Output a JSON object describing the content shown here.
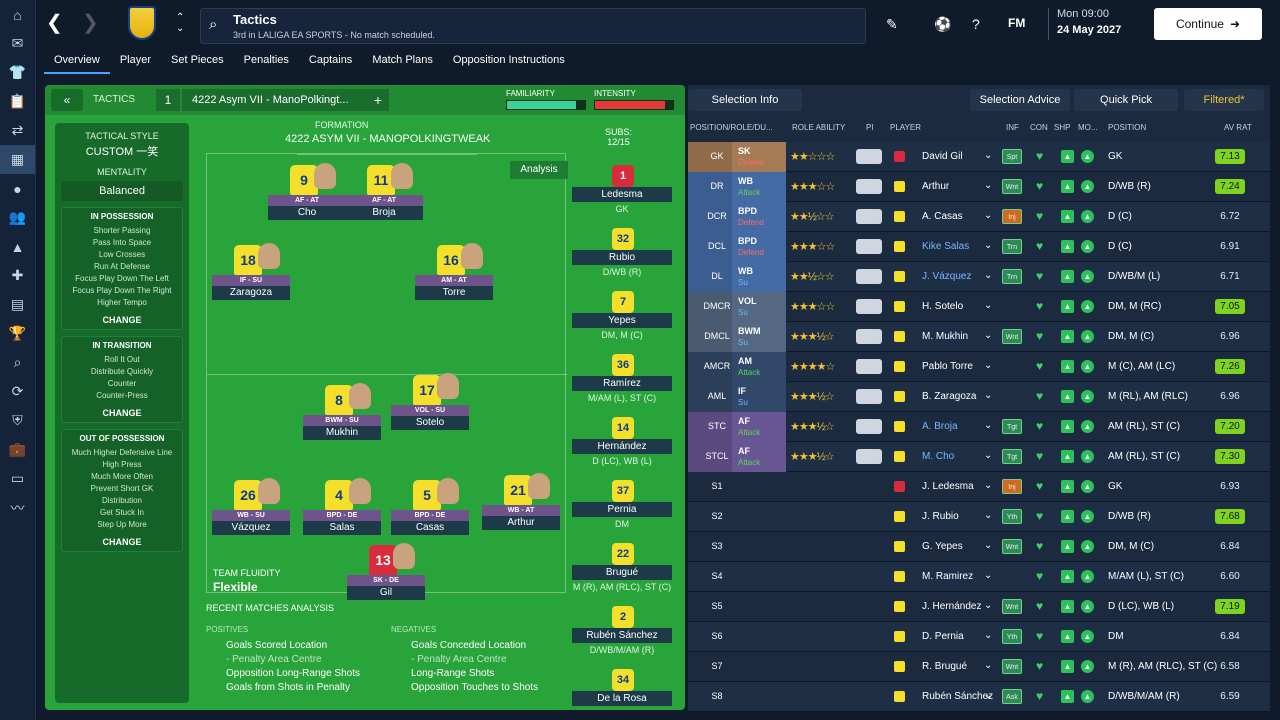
{
  "header": {
    "title": "Tactics",
    "subtitle": "3rd in LALIGA EA SPORTS - No match scheduled.",
    "date_day": "Mon 09:00",
    "date_full": "24 May 2027",
    "continue_label": "Continue",
    "fm_label": "FM"
  },
  "tabs": [
    "Overview",
    "Player",
    "Set Pieces",
    "Penalties",
    "Captains",
    "Match Plans",
    "Opposition Instructions"
  ],
  "tactics": {
    "label": "TACTICS",
    "slot": "1",
    "name": "4222 Asym VII - ManoPolkingt...",
    "familiarity_label": "FAMILIARITY",
    "intensity_label": "INTENSITY",
    "familiarity": 0.88,
    "intensity": 0.9,
    "style_title": "TACTICAL STYLE",
    "style_value": "CUSTOM 一笑",
    "mentality_title": "MENTALITY",
    "mentality_value": "Balanced",
    "possession_title": "IN POSSESSION",
    "possession_items": [
      "Shorter Passing",
      "Pass Into Space",
      "Low Crosses",
      "Run At Defense",
      "Focus Play Down The Left",
      "Focus Play Down The Right",
      "Higher Tempo"
    ],
    "transition_title": "IN TRANSITION",
    "transition_items": [
      "Roll It Out",
      "Distribute Quickly",
      "Counter",
      "Counter-Press"
    ],
    "oop_title": "OUT OF POSSESSION",
    "oop_items": [
      "Much Higher Defensive Line",
      "High Press",
      "Much More Often",
      "Prevent Short GK",
      "Distribution",
      "Get Stuck In",
      "Step Up More"
    ],
    "change_label": "CHANGE",
    "formation_title": "FORMATION",
    "formation_name": "4222 ASYM VII - MANOPOLKINGTWEAK",
    "subs_label": "SUBS:",
    "subs_count": "12/15",
    "analysis_label": "Analysis",
    "fluidity_label": "TEAM FLUIDITY",
    "fluidity_value": "Flexible",
    "recent_label": "RECENT MATCHES ANALYSIS",
    "positives_label": "POSITIVES",
    "negatives_label": "NEGATIVES",
    "positives": [
      "Goals Scored Location",
      "- Penalty Area Centre",
      "Opposition Long-Range Shots",
      "Goals from Shots in Penalty"
    ],
    "negatives": [
      "Goals Conceded Location",
      "- Penalty Area Centre",
      "Long-Range Shots",
      "Opposition Touches to Shots"
    ]
  },
  "pitch_players": [
    {
      "num": "9",
      "role": "AF - AT",
      "name": "Cho"
    },
    {
      "num": "11",
      "role": "AF - AT",
      "name": "Broja"
    },
    {
      "num": "18",
      "role": "IF - SU",
      "name": "Zaragoza"
    },
    {
      "num": "16",
      "role": "AM - AT",
      "name": "Torre"
    },
    {
      "num": "8",
      "role": "BWM - SU",
      "name": "Mukhin"
    },
    {
      "num": "17",
      "role": "VOL - SU",
      "name": "Sotelo"
    },
    {
      "num": "26",
      "role": "WB - SU",
      "name": "Vázquez"
    },
    {
      "num": "4",
      "role": "BPD - DE",
      "name": "Salas"
    },
    {
      "num": "5",
      "role": "BPD - DE",
      "name": "Casas"
    },
    {
      "num": "21",
      "role": "WB - AT",
      "name": "Arthur"
    },
    {
      "num": "13",
      "role": "SK - DE",
      "name": "Gil"
    }
  ],
  "subs": [
    {
      "num": "1",
      "name": "Ledesma",
      "pos": "GK"
    },
    {
      "num": "32",
      "name": "Rubio",
      "pos": "D/WB (R)"
    },
    {
      "num": "7",
      "name": "Yepes",
      "pos": "DM, M (C)"
    },
    {
      "num": "36",
      "name": "Ramírez",
      "pos": "M/AM (L), ST (C)"
    },
    {
      "num": "14",
      "name": "Hernández",
      "pos": "D (LC), WB (L)"
    },
    {
      "num": "37",
      "name": "Pernia",
      "pos": "DM"
    },
    {
      "num": "22",
      "name": "Brugué",
      "pos": "M (R), AM (RLC), ST (C)"
    },
    {
      "num": "2",
      "name": "Rubén Sánchez",
      "pos": "D/WB/M/AM (R)"
    },
    {
      "num": "34",
      "name": "De la Rosa",
      "pos": ""
    }
  ],
  "right": {
    "selection_info": "Selection Info",
    "selection_advice": "Selection Advice",
    "quick_pick": "Quick Pick",
    "filtered": "Filtered*",
    "columns": [
      "POSITION/ROLE/DU...",
      "ROLE ABILITY",
      "PI",
      "PLAYER",
      "INF",
      "CON",
      "SHP",
      "MO...",
      "POSITION",
      "AV RAT"
    ],
    "rows": [
      {
        "pos": "GK",
        "role": "SK",
        "duty": "Defend",
        "duty_cls": "def",
        "stars": "★★☆☆☆",
        "name": "David Gil",
        "gk": true,
        "inf": "Spt",
        "posn": "GK",
        "rat": "7.13",
        "hi": true
      },
      {
        "pos": "DR",
        "role": "WB",
        "duty": "Attack",
        "duty_cls": "att",
        "stars": "★★★☆☆",
        "name": "Arthur",
        "inf": "Wnt",
        "posn": "D/WB (R)",
        "rat": "7.24",
        "hi": true
      },
      {
        "pos": "DCR",
        "role": "BPD",
        "duty": "Defend",
        "duty_cls": "def",
        "stars": "★★½☆☆",
        "name": "A. Casas",
        "inf": "Inj",
        "posn": "D (C)",
        "rat": "6.72"
      },
      {
        "pos": "DCL",
        "role": "BPD",
        "duty": "Defend",
        "duty_cls": "def",
        "stars": "★★★☆☆",
        "name": "Kike Salas",
        "link": true,
        "inf": "Trn",
        "posn": "D (C)",
        "rat": "6.91"
      },
      {
        "pos": "DL",
        "role": "WB",
        "duty": "Su",
        "duty_cls": "su",
        "stars": "★★½☆☆",
        "name": "J. Vázquez",
        "link": true,
        "inf": "Trn",
        "posn": "D/WB/M (L)",
        "rat": "6.71"
      },
      {
        "pos": "DMCR",
        "role": "VOL",
        "duty": "Su",
        "duty_cls": "su",
        "stars": "★★★☆☆",
        "name": "H. Sotelo",
        "inf": "",
        "posn": "DM, M (RC)",
        "rat": "7.05",
        "hi": true
      },
      {
        "pos": "DMCL",
        "role": "BWM",
        "duty": "Su",
        "duty_cls": "su",
        "stars": "★★★½☆",
        "name": "M. Mukhin",
        "inf": "Wnt",
        "posn": "DM, M (C)",
        "rat": "6.96"
      },
      {
        "pos": "AMCR",
        "role": "AM",
        "duty": "Attack",
        "duty_cls": "att",
        "stars": "★★★★☆",
        "name": "Pablo Torre",
        "inf": "",
        "posn": "M (C), AM (LC)",
        "rat": "7.26",
        "hi": true
      },
      {
        "pos": "AML",
        "role": "IF",
        "duty": "Su",
        "duty_cls": "su",
        "stars": "★★★½☆",
        "name": "B. Zaragoza",
        "inf": "",
        "posn": "M (RL), AM (RLC)",
        "rat": "6.96"
      },
      {
        "pos": "STC",
        "role": "AF",
        "duty": "Attack",
        "duty_cls": "att",
        "stars": "★★★½☆",
        "name": "A. Broja",
        "link": true,
        "inf": "Tgt",
        "posn": "AM (RL), ST (C)",
        "rat": "7.20",
        "hi": true
      },
      {
        "pos": "STCL",
        "role": "AF",
        "duty": "Attack",
        "duty_cls": "att",
        "stars": "★★★½☆",
        "name": "M. Cho",
        "link": true,
        "inf": "Tgt",
        "posn": "AM (RL), ST (C)",
        "rat": "7.30",
        "hi": true
      },
      {
        "pos": "S1",
        "role": "",
        "duty": "",
        "duty_cls": "",
        "stars": "",
        "name": "J. Ledesma",
        "gk": true,
        "inf": "Inj",
        "posn": "GK",
        "rat": "6.93"
      },
      {
        "pos": "S2",
        "role": "",
        "duty": "",
        "duty_cls": "",
        "stars": "",
        "name": "J. Rubio",
        "inf": "Yth",
        "posn": "D/WB (R)",
        "rat": "7.68",
        "hi": true
      },
      {
        "pos": "S3",
        "role": "",
        "duty": "",
        "duty_cls": "",
        "stars": "",
        "name": "G. Yepes",
        "inf": "Wnt",
        "posn": "DM, M (C)",
        "rat": "6.84"
      },
      {
        "pos": "S4",
        "role": "",
        "duty": "",
        "duty_cls": "",
        "stars": "",
        "name": "M. Ramirez",
        "inf": "",
        "posn": "M/AM (L), ST (C)",
        "rat": "6.60"
      },
      {
        "pos": "S5",
        "role": "",
        "duty": "",
        "duty_cls": "",
        "stars": "",
        "name": "J. Hernández",
        "inf": "Wnt",
        "posn": "D (LC), WB (L)",
        "rat": "7.19",
        "hi": true
      },
      {
        "pos": "S6",
        "role": "",
        "duty": "",
        "duty_cls": "",
        "stars": "",
        "name": "D. Pernia",
        "inf": "Yth",
        "posn": "DM",
        "rat": "6.84"
      },
      {
        "pos": "S7",
        "role": "",
        "duty": "",
        "duty_cls": "",
        "stars": "",
        "name": "R. Brugué",
        "inf": "Wnt",
        "posn": "M (R), AM (RLC), ST (C)",
        "rat": "6.58"
      },
      {
        "pos": "S8",
        "role": "",
        "duty": "",
        "duty_cls": "",
        "stars": "",
        "name": "Rubén Sánchez",
        "inf": "Ask",
        "posn": "D/WB/M/AM (R)",
        "rat": "6.59"
      }
    ]
  }
}
